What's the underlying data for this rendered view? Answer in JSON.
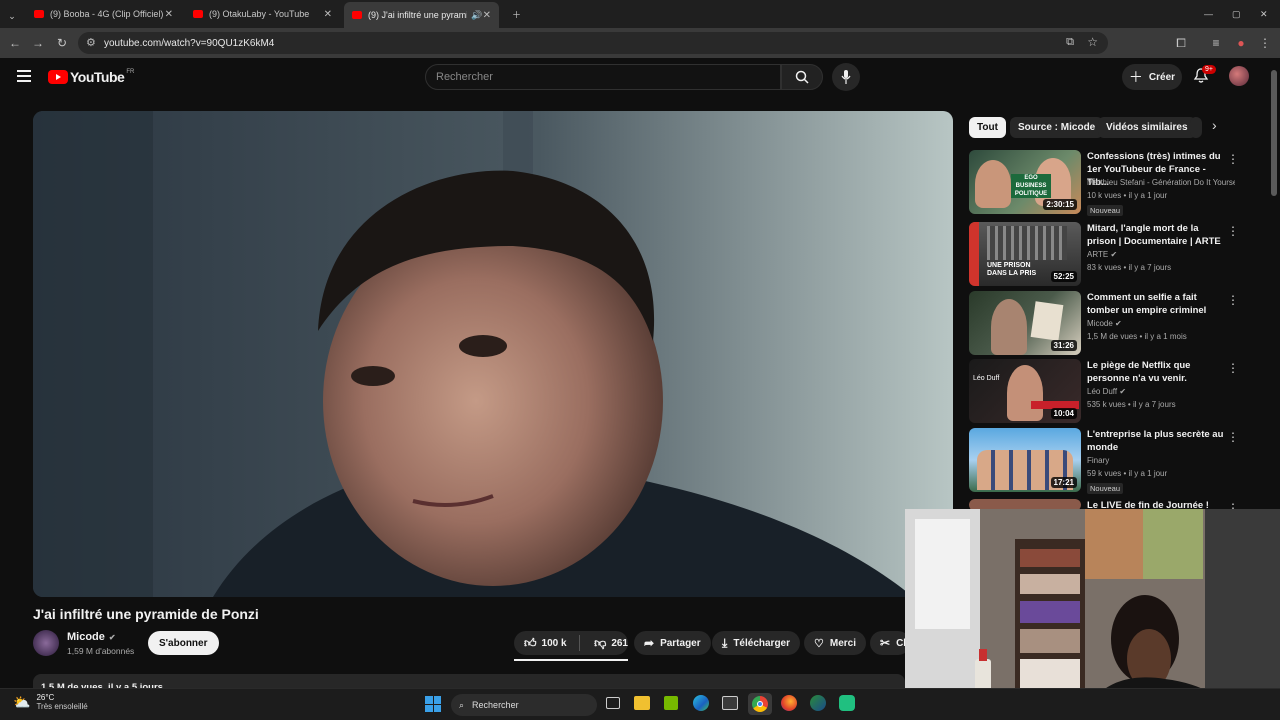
{
  "browser": {
    "tabs": [
      {
        "title": "(9) Booba - 4G (Clip Officiel) - Y"
      },
      {
        "title": "(9) OtakuLaby - YouTube"
      },
      {
        "title": "(9) J'ai infiltré une pyramide"
      }
    ],
    "url": "youtube.com/watch?v=90QU1zK6kM4"
  },
  "header": {
    "logo_text": "YouTube",
    "logo_region": "FR",
    "search_placeholder": "Rechercher",
    "create_label": "Créer",
    "notif_count": "9+"
  },
  "video": {
    "title": "J'ai infiltré une pyramide de Ponzi",
    "channel": "Micode",
    "subscribers": "1,59 M d'abonnés",
    "subscribe_label": "S'abonner",
    "likes": "100 k",
    "dislikes": "261",
    "share_label": "Partager",
    "download_label": "Télécharger",
    "thanks_label": "Merci",
    "clip_label": "Cl",
    "description_stats": "1,5 M de vues  il y a 5 jours"
  },
  "sidebar": {
    "chips": [
      "Tout",
      "Source : Micode",
      "Vidéos similaires"
    ],
    "recommendations": [
      {
        "title": "Confessions (très) intimes du 1er YouTubeur de France - Tib...",
        "channel": "Matthieu Stefani - Génération Do It Yourself",
        "meta": "10 k vues • il y a 1 jour",
        "badge": "Nouveau",
        "duration": "2:30:15",
        "thumb_text": "EGO BUSINESS POLITIQUE"
      },
      {
        "title": "Mitard, l'angle mort de la prison | Documentaire | ARTE",
        "channel": "ARTE",
        "meta": "83 k vues • il y a 7 jours",
        "badge": "",
        "duration": "52:25",
        "thumb_text": "UNE PRISON DANS LA PRIS"
      },
      {
        "title": "Comment un selfie a fait tomber un empire criminel",
        "channel": "Micode",
        "meta": "1,5 M de vues • il y a 1 mois",
        "badge": "",
        "duration": "31:26",
        "thumb_text": ""
      },
      {
        "title": "Le piège de Netflix que personne n'a vu venir.",
        "channel": "Léo Duff",
        "meta": "535 k vues • il y a 7 jours",
        "badge": "",
        "duration": "10:04",
        "thumb_text": "Léo Duff"
      },
      {
        "title": "L'entreprise la plus secrète au monde",
        "channel": "Finary",
        "meta": "59 k vues • il y a 1 jour",
        "badge": "Nouveau",
        "duration": "17:21",
        "thumb_text": ""
      },
      {
        "title": "Le LIVE de fin de Journée !",
        "channel": "",
        "meta": "",
        "badge": "",
        "duration": "",
        "thumb_text": ""
      }
    ]
  },
  "taskbar": {
    "weather_temp": "26°C",
    "weather_desc": "Très ensoleillé",
    "search_label": "Rechercher"
  },
  "colors": {
    "background": "#0f0f0f",
    "brand_red": "#ff0000",
    "chip_bg": "#272727",
    "text_secondary": "#aaaaaa"
  }
}
